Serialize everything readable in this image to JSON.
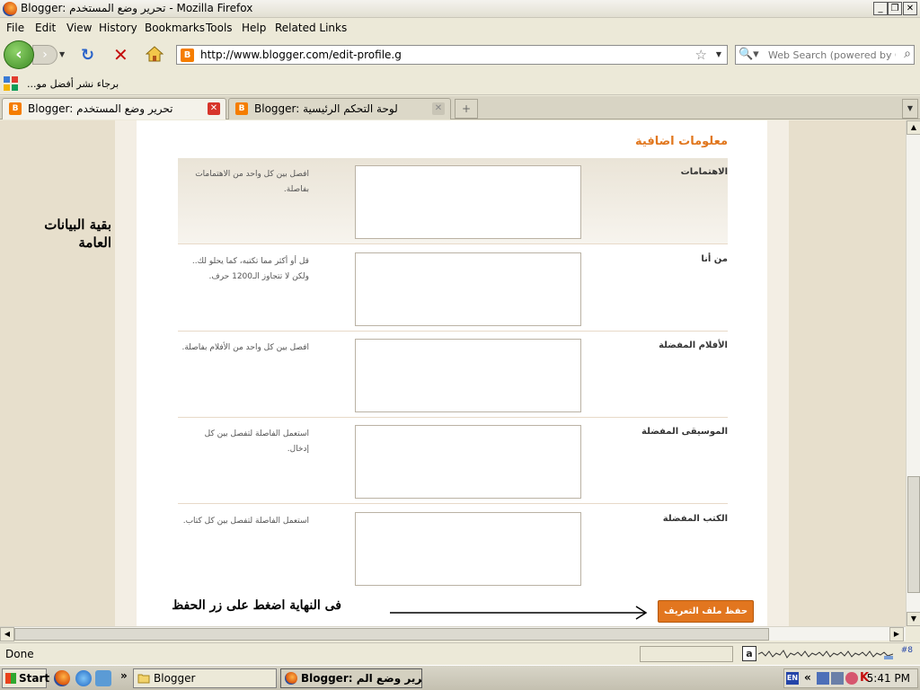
{
  "window": {
    "title": "Blogger: تحرير وضع المستخدم - Mozilla Firefox",
    "minimize": "_",
    "restore": "❐",
    "close": "✕"
  },
  "menu": [
    "File",
    "Edit",
    "View",
    "History",
    "Bookmarks",
    "Tools",
    "Help",
    "Related Links"
  ],
  "nav": {
    "url": "http://www.blogger.com/edit-profile.g",
    "search_placeholder": "Web Search (powered by Google)",
    "back_icon": "back-arrow-icon",
    "forward_icon": "forward-arrow-icon",
    "reload_icon": "reload-icon",
    "stop_icon": "stop-icon",
    "home_icon": "home-icon"
  },
  "bookmarks": {
    "item": "...برجاء نشر أفضل مو"
  },
  "tabs": [
    {
      "label": "Blogger: تحرير وضع المستخدم",
      "active": true
    },
    {
      "label": "Blogger: لوحة التحكم الرئيسية",
      "active": false
    }
  ],
  "page": {
    "section_title": "معلومات اضافية",
    "side_annotation": "بقية البيانات العامة",
    "rows": [
      {
        "label": "الاهتمامات",
        "hint": "افصل بين كل واحد من الاهتمامات بفاصلة."
      },
      {
        "label": "من أنا",
        "hint": "قل أو أكثر مما تكتبه، كما يحلو لك.. ولكن لا تتجاوز الـ1200 حرف."
      },
      {
        "label": "الأفلام المفضلة",
        "hint": "افصل بين كل واحد من الأفلام بفاصلة."
      },
      {
        "label": "الموسيقى المفضلة",
        "hint": "استعمل الفاصلة لتفصل بين كل إدخال."
      },
      {
        "label": "الكتب المفضلة",
        "hint": "استعمل الفاصلة لتفصل بين كل كتاب."
      }
    ],
    "save_button": "حفظ ملف التعريف",
    "bottom_annotation": "فى النهاية اضغط على زر الحفظ"
  },
  "status": {
    "text": "Done",
    "ext_count": "#8"
  },
  "taskbar": {
    "start": "Start",
    "items": [
      {
        "label": "Blogger",
        "pressed": false
      },
      {
        "label": "Blogger: تحرير وضع الم...",
        "pressed": true
      }
    ],
    "clock": "5:41 PM",
    "lang": "EN"
  },
  "colors": {
    "accent": "#e1771e",
    "page_bg": "#e7dfcc"
  }
}
